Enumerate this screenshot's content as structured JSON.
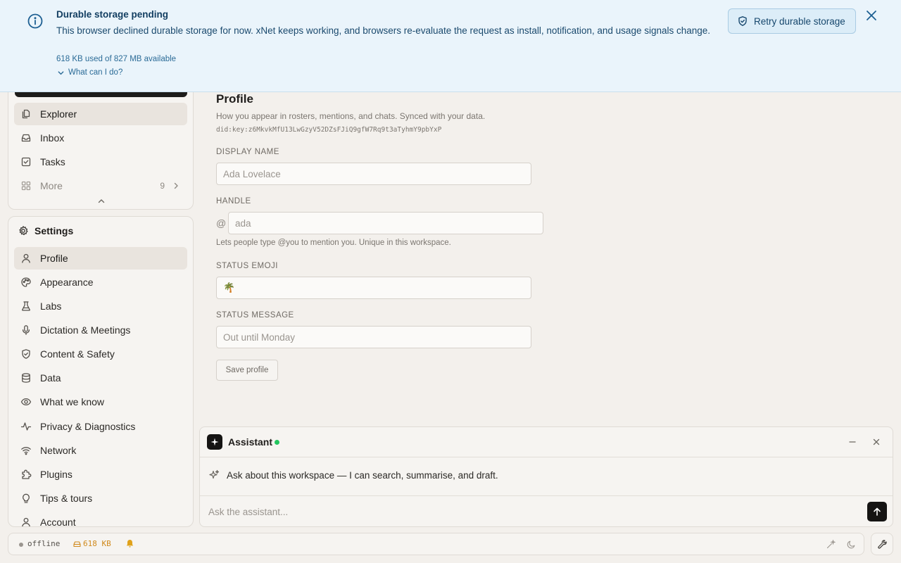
{
  "banner": {
    "title": "Durable storage pending",
    "message": "This browser declined durable storage for now. xNet keeps working, and browsers re-evaluate the request as install, notification, and usage signals change.",
    "usage": "618 KB used of 827 MB available",
    "help_link": "What can I do?",
    "retry_label": "Retry durable storage",
    "info_icon": "info-icon",
    "close_icon": "close-icon",
    "accent_color": "#1d5f92",
    "background_color": "#eaf4fb"
  },
  "nav": {
    "items": [
      {
        "label": "Explorer",
        "icon": "files-icon",
        "active": true
      },
      {
        "label": "Inbox",
        "icon": "inbox-icon"
      },
      {
        "label": "Tasks",
        "icon": "checkbox-icon"
      },
      {
        "label": "More",
        "icon": "grid-icon",
        "count": "9"
      }
    ]
  },
  "settings": {
    "title": "Settings",
    "items": [
      {
        "label": "Profile",
        "icon": "user-icon",
        "active": true
      },
      {
        "label": "Appearance",
        "icon": "palette-icon"
      },
      {
        "label": "Labs",
        "icon": "flask-icon"
      },
      {
        "label": "Dictation & Meetings",
        "icon": "mic-icon"
      },
      {
        "label": "Content & Safety",
        "icon": "shield-check-icon"
      },
      {
        "label": "Data",
        "icon": "database-icon"
      },
      {
        "label": "What we know",
        "icon": "eye-icon"
      },
      {
        "label": "Privacy & Diagnostics",
        "icon": "activity-icon"
      },
      {
        "label": "Network",
        "icon": "wifi-icon"
      },
      {
        "label": "Plugins",
        "icon": "puzzle-icon"
      },
      {
        "label": "Tips & tours",
        "icon": "lightbulb-icon"
      },
      {
        "label": "Account",
        "icon": "account-icon"
      }
    ]
  },
  "profile": {
    "title": "Profile",
    "subtitle": "How you appear in rosters, mentions, and chats. Synced with your data.",
    "did": "did:key:z6MkvkMfU13LwGzyV52DZsFJiQ9gfW7Rq9t3aTyhmY9pbYxP",
    "display_name": {
      "label": "DISPLAY NAME",
      "placeholder": "Ada Lovelace",
      "value": ""
    },
    "handle": {
      "label": "HANDLE",
      "prefix": "@",
      "placeholder": "ada",
      "value": "",
      "help": "Lets people type @you to mention you. Unique in this workspace."
    },
    "status_emoji": {
      "label": "STATUS EMOJI",
      "value": "🌴"
    },
    "status_message": {
      "label": "STATUS MESSAGE",
      "placeholder": "Out until Monday",
      "value": ""
    },
    "save_label": "Save profile"
  },
  "assistant": {
    "title": "Assistant",
    "status_color": "#22c55e",
    "intro": "Ask about this workspace — I can search, summarise, and draft.",
    "input_placeholder": "Ask the assistant..."
  },
  "statusbar": {
    "connection": "offline",
    "storage": "618 KB"
  }
}
